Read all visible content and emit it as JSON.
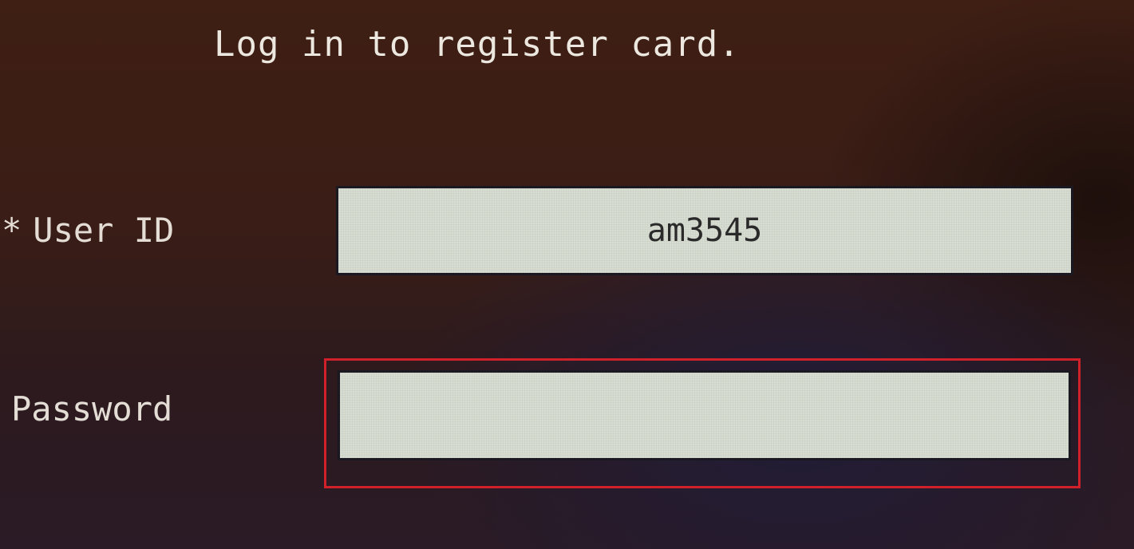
{
  "instruction": "Log in to register card.",
  "fields": {
    "user_id": {
      "required_mark": "*",
      "label": "User ID",
      "value": "am3545"
    },
    "password": {
      "label": "Password",
      "value": ""
    }
  },
  "colors": {
    "focus_highlight": "#d0202a",
    "input_background": "#d8ddd2"
  }
}
